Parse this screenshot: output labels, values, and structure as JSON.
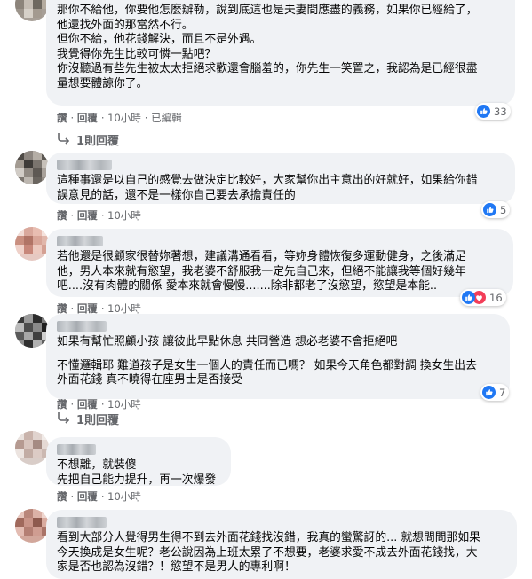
{
  "comments": [
    {
      "lines": [
        "那你不給他，你要他怎麼辦勒，說到底這也是夫妻間應盡的義務，如果你已經給了，",
        "他還找外面的那當然不行。",
        "但你不給，他花錢解決，而且不是外遇。",
        "我覺得你先生比較可憐一點吧？",
        "你沒聽過有些先生被太太拒絕求歡還會腦羞的，你先生一笑置之，我認為是已經很盡",
        "量想要體諒你了。"
      ],
      "actions": [
        "讚",
        "回覆",
        "10小時",
        "已編輯"
      ],
      "reactions": {
        "icons": [
          "like-icon"
        ],
        "count": "33"
      },
      "replies_label": "1則回覆"
    },
    {
      "lines": [
        "這種事還是以自己的感覺去做決定比較好，大家幫你出主意出的好就好，如果給你錯",
        "誤意見的話，還不是一樣你自己要去承擔責任的"
      ],
      "actions": [
        "讚",
        "回覆",
        "10小時"
      ],
      "reactions": {
        "icons": [
          "like-icon"
        ],
        "count": "5"
      }
    },
    {
      "lines": [
        "若他還是很顧家很替妳著想，建議溝通看看，等妳身體恢復多運動健身，之後滿足",
        "他，男人本來就有慾望，我老婆不舒服我一定先自己來，但絕不能讓我等個好幾年",
        "吧....沒有肉體的關係 愛本來就會慢慢.......除非都老了沒慾望，慾望是本能.."
      ],
      "actions": [
        "讚",
        "回覆",
        "10小時"
      ],
      "reactions": {
        "icons": [
          "like-icon",
          "love-icon"
        ],
        "count": "16"
      }
    },
    {
      "lines": [
        "如果有幫忙照顧小孩 讓彼此早點休息 共同營造 想必老婆不會拒絕吧",
        "",
        "不懂邏輯耶 難道孩子是女生一個人的責任而已嗎？ 如果今天角色都對調 換女生出去",
        "外面花錢 真不曉得在座男士是否接受"
      ],
      "actions": [
        "讚",
        "回覆",
        "10小時"
      ],
      "reactions": {
        "icons": [
          "like-icon"
        ],
        "count": "7"
      },
      "replies_label": "1則回覆"
    },
    {
      "lines": [
        "不想離，就裝傻",
        "先把自己能力提升，再一次爆發"
      ],
      "actions": [
        "讚",
        "回覆",
        "10小時"
      ]
    },
    {
      "lines": [
        "看到大部分人覺得男生得不到去外面花錢找沒錯，我真的蠻驚訝的... 就想問問那如果",
        "今天換成是女生呢？老公說因為上班太累了不想要，老婆求愛不成去外面花錢找，大",
        "家是否也認為沒錯？！慾望不是男人的專利啊！"
      ]
    }
  ],
  "colors": {
    "like_blue": "#2078f4",
    "love_red": "#f33e58",
    "bubble_bg": "#f0f2f5",
    "meta_gray": "#65676b"
  }
}
